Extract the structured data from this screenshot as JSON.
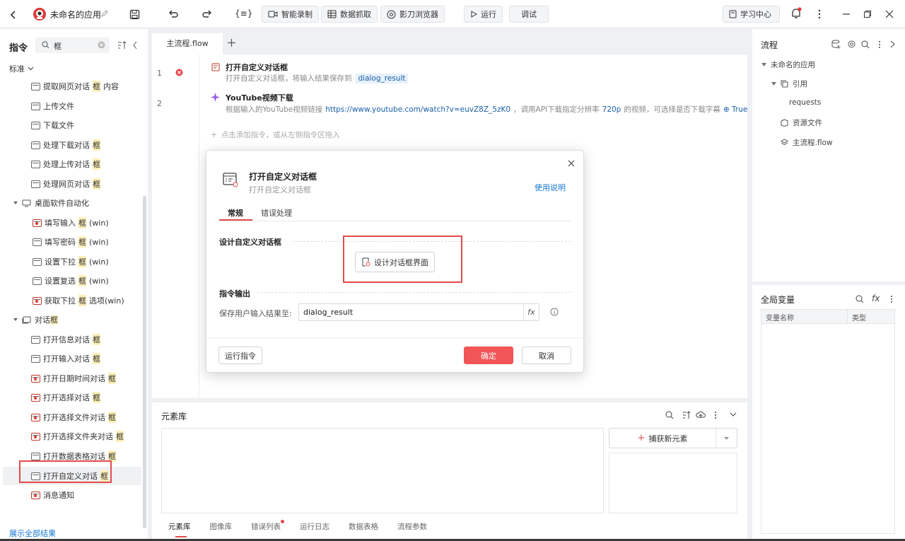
{
  "topbar": {
    "app_name": "未命名的应用",
    "expr_label": "{≡}",
    "smart_record": "智能录制",
    "data_scrape": "数据抓取",
    "browser": "影刀浏览器",
    "run": "运行",
    "debug": "调试",
    "learning_center": "学习中心"
  },
  "left": {
    "title": "指令",
    "search_value": "框",
    "standard": "标准",
    "items_web": [
      {
        "pre": "提取网页对话",
        "hl": "框",
        "post": "内容"
      },
      {
        "pre": "上传文件",
        "hl": "",
        "post": ""
      },
      {
        "pre": "下载文件",
        "hl": "",
        "post": ""
      },
      {
        "pre": "处理下载对话",
        "hl": "框",
        "post": ""
      },
      {
        "pre": "处理上传对话",
        "hl": "框",
        "post": ""
      },
      {
        "pre": "处理网页对话",
        "hl": "框",
        "post": ""
      }
    ],
    "group_desktop": "桌面软件自动化",
    "items_desktop": [
      {
        "pre": "填写输入",
        "hl": "框",
        "post": "(win)"
      },
      {
        "pre": "填写密码",
        "hl": "框",
        "post": "(win)"
      },
      {
        "pre": "设置下拉",
        "hl": "框",
        "post": "(win)"
      },
      {
        "pre": "设置复选",
        "hl": "框",
        "post": "(win)"
      },
      {
        "pre": "获取下拉",
        "hl": "框",
        "post": "选项(win)"
      }
    ],
    "group_dialog": {
      "pre": "对话",
      "hl": "框"
    },
    "items_dialog": [
      {
        "pre": "打开信息对话",
        "hl": "框",
        "post": ""
      },
      {
        "pre": "打开输入对话",
        "hl": "框",
        "post": ""
      },
      {
        "pre": "打开日期时间对话",
        "hl": "框",
        "post": ""
      },
      {
        "pre": "打开选择对话",
        "hl": "框",
        "post": ""
      },
      {
        "pre": "打开选择文件对话",
        "hl": "框",
        "post": ""
      },
      {
        "pre": "打开选择文件夹对话",
        "hl": "框",
        "post": ""
      },
      {
        "pre": "打开数据表格对话",
        "hl": "框",
        "post": ""
      },
      {
        "pre": "打开自定义对话",
        "hl": "框",
        "post": ""
      },
      {
        "pre": "消息通知",
        "hl": "",
        "post": ""
      }
    ],
    "show_all": "展示全部结果"
  },
  "editor": {
    "tab": "主流程.flow",
    "steps": [
      {
        "num": "1",
        "title": "打开自定义对话框",
        "desc": "打开自定义对话框，将输入结果保存到",
        "var": "dialog_result"
      },
      {
        "num": "2",
        "title": "YouTube视频下载",
        "desc_pre": "根据输入的YouTube视频链接",
        "link": "https://www.youtube.com/watch?v=euvZ8Z_5zK0",
        "desc_mid": "，调用API下载指定分辨率",
        "res": "720p",
        "desc_post": "的视频，可选择是否下载字幕",
        "flag": "True"
      }
    ],
    "add_hint": "点击添加指令，或从左侧指令区拖入"
  },
  "dialog": {
    "title": "打开自定义对话框",
    "subtitle": "打开自定义对话框",
    "help": "使用说明",
    "tab_general": "常规",
    "tab_error": "错误处理",
    "section_design": "设计自定义对话框",
    "design_button": "设计对话框界面",
    "section_output": "指令输出",
    "save_label": "保存用户输入结果至:",
    "save_value": "dialog_result",
    "fx": "fx",
    "run_cmd": "运行指令",
    "ok": "确定",
    "cancel": "取消"
  },
  "elib": {
    "title": "元素库",
    "capture": "捕获新元素",
    "tabs": [
      "元素库",
      "图像库",
      "错误列表",
      "运行日志",
      "数据表格",
      "流程参数"
    ]
  },
  "flow": {
    "title": "流程",
    "root": "未命名的应用",
    "ref": "引用",
    "requests": "requests",
    "resources": "资源文件",
    "main": "主流程.flow"
  },
  "vars": {
    "title": "全局变量",
    "col_name": "变量名称",
    "col_type": "类型",
    "fx": "fx"
  },
  "colors": {
    "accent": "#1677d2",
    "primary_red": "#f25555",
    "highlight": "#fdf0b8",
    "annotation_red": "#e24b4b"
  }
}
